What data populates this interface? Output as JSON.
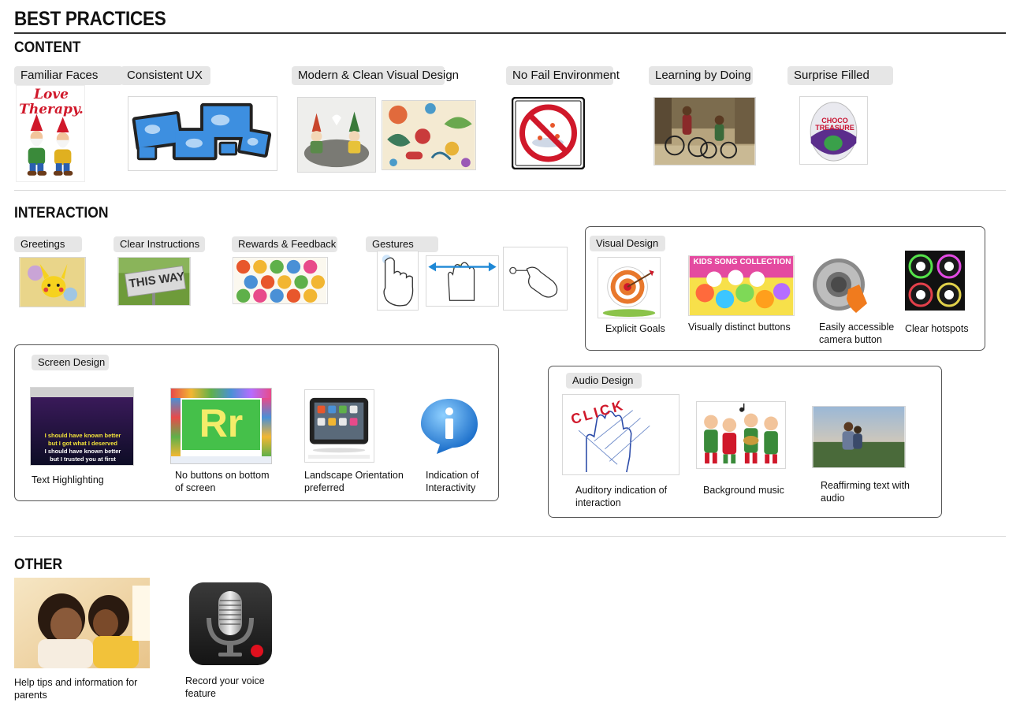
{
  "title": "BEST PRACTICES",
  "sections": {
    "content": {
      "heading": "CONTENT",
      "items": [
        {
          "label": "Familiar Faces",
          "image_text": "Love Therapy."
        },
        {
          "label": "Consistent UX"
        },
        {
          "label": "Modern & Clean Visual Design"
        },
        {
          "label": "No Fail Environment"
        },
        {
          "label": "Learning by Doing"
        },
        {
          "label": "Surprise Filled",
          "image_text": "CHOCO TREASURE"
        }
      ]
    },
    "interaction": {
      "heading": "INTERACTION",
      "items": [
        {
          "label": "Greetings"
        },
        {
          "label": "Clear Instructions",
          "image_text": "THIS WAY"
        },
        {
          "label": "Rewards & Feedback"
        },
        {
          "label": "Gestures"
        }
      ],
      "visual_design": {
        "label": "Visual Design",
        "items": [
          {
            "caption": "Explicit Goals"
          },
          {
            "caption": "Visually distinct buttons",
            "image_text": "KIDS SONG COLLECTION"
          },
          {
            "caption": "Easily accessible camera button"
          },
          {
            "caption": "Clear hotspots"
          }
        ]
      },
      "screen_design": {
        "label": "Screen Design",
        "items": [
          {
            "caption": "Text Highlighting",
            "lyrics": [
              "I should have known better",
              "but I got what I deserved",
              "I should have known better",
              "but I trusted you at first"
            ]
          },
          {
            "caption": "No buttons on bottom of screen",
            "image_text": "Rr"
          },
          {
            "caption": "Landscape Orientation preferred"
          },
          {
            "caption": "Indication of Interactivity"
          }
        ]
      },
      "audio_design": {
        "label": "Audio Design",
        "items": [
          {
            "caption": "Auditory indication of interaction",
            "image_text": "CLICK"
          },
          {
            "caption": "Background music"
          },
          {
            "caption": "Reaffirming text with audio"
          }
        ]
      }
    },
    "other": {
      "heading": "OTHER",
      "items": [
        {
          "caption": "Help tips and information for parents"
        },
        {
          "caption": "Record your voice feature"
        }
      ]
    }
  },
  "colors": {
    "rule": "#333333",
    "tag_bg": "#e6e6e6",
    "box_border": "#555555",
    "accent_red": "#d0182a",
    "accent_blue": "#1e88d6"
  }
}
